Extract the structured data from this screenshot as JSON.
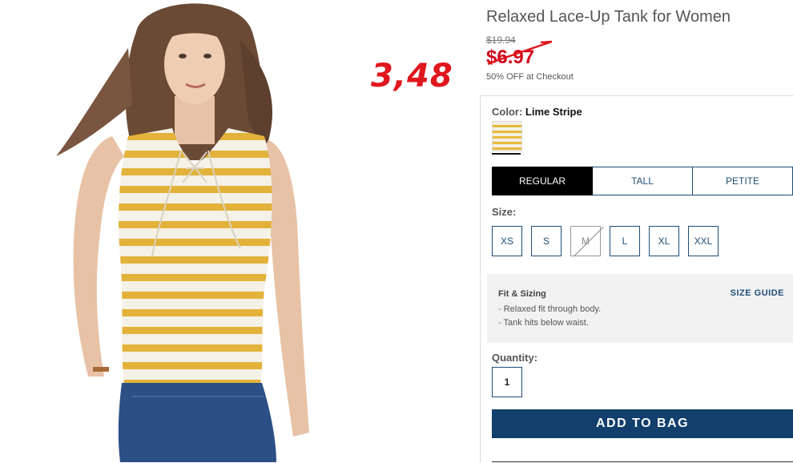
{
  "product": {
    "title": "Relaxed Lace-Up Tank for Women",
    "original_price": "$19.94",
    "sale_price": "$6.97",
    "promo": "50% OFF at Checkout",
    "annotation": "3,48"
  },
  "color": {
    "label": "Color:",
    "value": "Lime Stripe",
    "swatch_colors": [
      "#f3f0e4",
      "#e6b93a"
    ]
  },
  "fit_tabs": [
    {
      "label": "REGULAR",
      "active": true
    },
    {
      "label": "TALL",
      "active": false
    },
    {
      "label": "PETITE",
      "active": false
    }
  ],
  "size": {
    "label": "Size:",
    "options": [
      {
        "label": "XS",
        "available": true
      },
      {
        "label": "S",
        "available": true
      },
      {
        "label": "M",
        "available": false
      },
      {
        "label": "L",
        "available": true
      },
      {
        "label": "XL",
        "available": true
      },
      {
        "label": "XXL",
        "available": true
      }
    ]
  },
  "fit_sizing": {
    "title": "Fit & Sizing",
    "guide_link": "SIZE GUIDE",
    "details": [
      "Relaxed fit through body.",
      "Tank hits below waist."
    ]
  },
  "quantity": {
    "label": "Quantity:",
    "value": "1"
  },
  "cta": {
    "add_to_bag": "ADD TO BAG"
  },
  "colors": {
    "brand_navy": "#123f6b",
    "sale_red": "#d0021b",
    "annotation_red": "#e0171d"
  }
}
